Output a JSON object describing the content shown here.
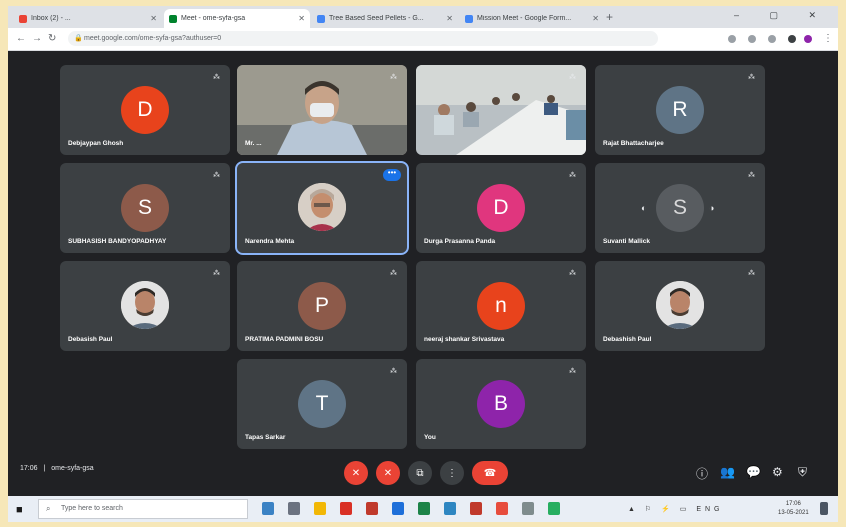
{
  "browser": {
    "tabs": [
      {
        "label": "Inbox (2) - ...",
        "active": false,
        "favicon_color": "#ea4335"
      },
      {
        "label": "Meet - ome-syfa-gsa",
        "active": true,
        "favicon_color": "#00832d"
      },
      {
        "label": "Tree Based Seed Pellets - G...",
        "active": false,
        "favicon_color": "#4285f4"
      },
      {
        "label": "Mission Meet - Google Form...",
        "active": false,
        "favicon_color": "#4285f4"
      }
    ],
    "newtab_label": "+",
    "window_controls": "– ▢ ✕",
    "url": "meet.google.com/ome-syfa-gsa?authuser=0"
  },
  "participants": [
    {
      "name": "Debjaypan Ghosh",
      "initial": "D",
      "color": "#e8431c",
      "type": "letter"
    },
    {
      "name": "Mr. ...",
      "type": "video-man"
    },
    {
      "name": "",
      "type": "video-room"
    },
    {
      "name": "Rajat Bhattacharjee",
      "initial": "R",
      "color": "#5f7486",
      "type": "letter"
    },
    {
      "name": "SUBHASISH BANDYOPADHYAY",
      "initial": "S",
      "color": "#8d5a4a",
      "type": "letter"
    },
    {
      "name": "Narendra Mehta",
      "type": "photo-woman",
      "speaking": true
    },
    {
      "name": "Durga Prasanna Panda",
      "initial": "D",
      "color": "#e0367e",
      "type": "letter"
    },
    {
      "name": "Suvanti Mallick",
      "initial": "S",
      "color": "#5f6368",
      "type": "letter-pinned"
    },
    {
      "name": "Debasish Paul",
      "type": "photo-man"
    },
    {
      "name": "PRATIMA PADMINI BOSU",
      "initial": "P",
      "color": "#8d5a4a",
      "type": "letter"
    },
    {
      "name": "neeraj shankar Srivastava",
      "initial": "n",
      "color": "#e8431c",
      "type": "letter"
    },
    {
      "name": "Debashish Paul",
      "type": "photo-man"
    },
    {
      "name": "Tapas Sarkar",
      "initial": "T",
      "color": "#5f7486",
      "type": "letter"
    },
    {
      "name": "You",
      "initial": "B",
      "color": "#8e24aa",
      "type": "letter"
    }
  ],
  "meeting": {
    "time": "17:06",
    "separator": "|",
    "code": "ome-syfa-gsa"
  },
  "controls": {
    "mic": "✕",
    "camera": "✕",
    "present": "⧉",
    "more": "⋮",
    "leave": "☎"
  },
  "right_controls": [
    "ⓘ",
    "👥",
    "💬",
    "⚙",
    "⛨"
  ],
  "taskbar": {
    "search_placeholder": "Type here to search",
    "time": "17:06",
    "date": "13-05-2021",
    "tray": "▲ ⚐ ⚡ ▭ ENG"
  },
  "colors": {
    "meet_bg": "#202124",
    "tile_bg": "#3c4043",
    "leave_red": "#ea4335",
    "accent_blue": "#1a73e8"
  }
}
